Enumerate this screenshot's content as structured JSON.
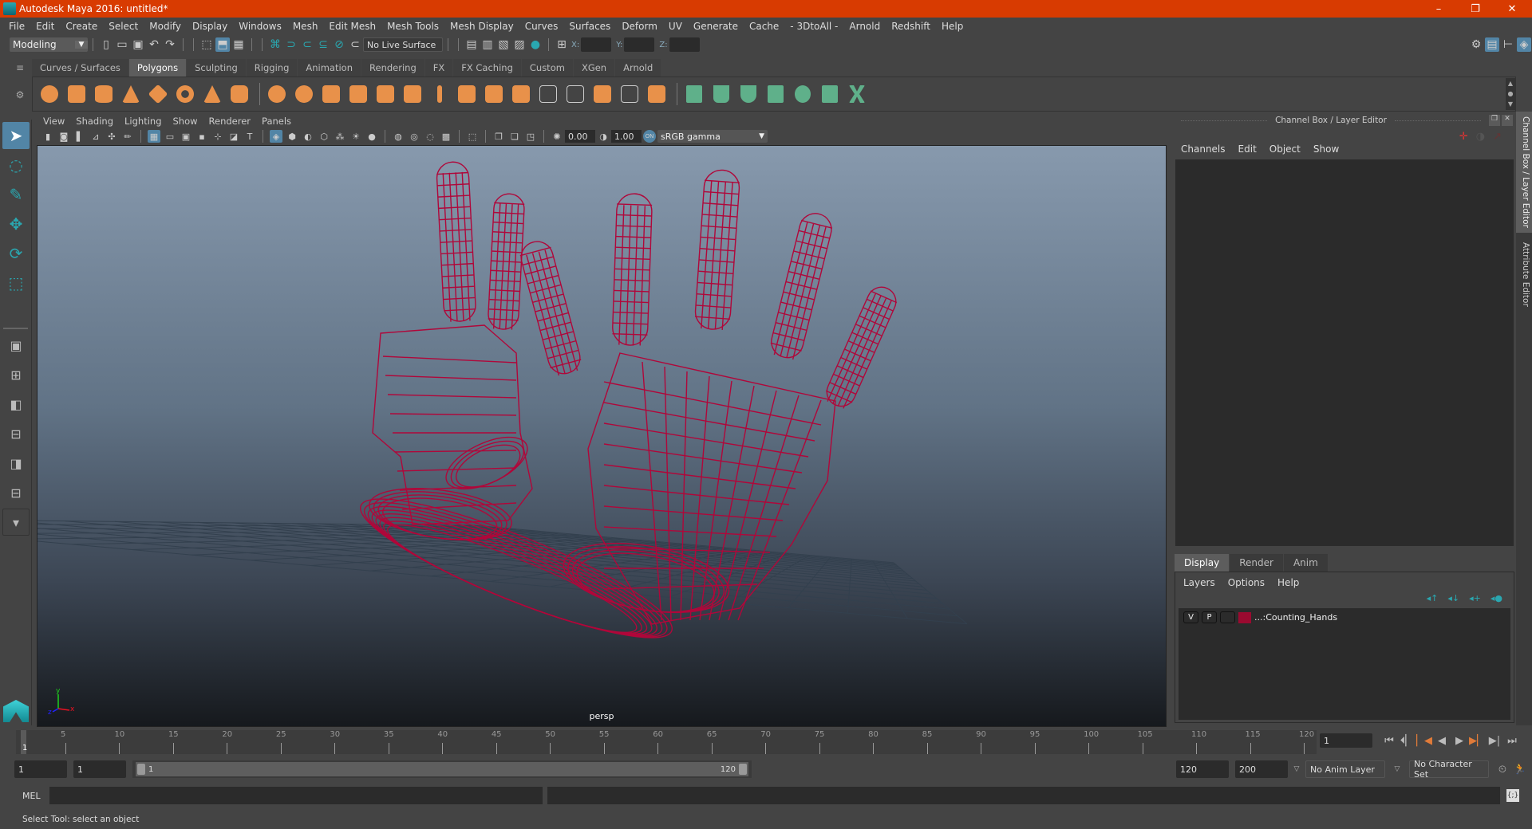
{
  "window": {
    "title": "Autodesk Maya 2016: untitled*",
    "minimize": "–",
    "restore": "❐",
    "close": "✕"
  },
  "menubar": [
    "File",
    "Edit",
    "Create",
    "Select",
    "Modify",
    "Display",
    "Windows",
    "Mesh",
    "Edit Mesh",
    "Mesh Tools",
    "Mesh Display",
    "Curves",
    "Surfaces",
    "Deform",
    "UV",
    "Generate",
    "Cache",
    "- 3DtoAll -",
    "Arnold",
    "Redshift",
    "Help"
  ],
  "statusline": {
    "menuset": "Modeling",
    "live_surface": "No Live Surface",
    "x_label": "X:",
    "y_label": "Y:",
    "z_label": "Z:",
    "x_value": "",
    "y_value": "",
    "z_value": ""
  },
  "shelf": {
    "tabs": [
      "Curves / Surfaces",
      "Polygons",
      "Sculpting",
      "Rigging",
      "Animation",
      "Rendering",
      "FX",
      "FX Caching",
      "Custom",
      "XGen",
      "Arnold"
    ],
    "active_tab": "Polygons"
  },
  "viewport": {
    "menu": [
      "View",
      "Shading",
      "Lighting",
      "Show",
      "Renderer",
      "Panels"
    ],
    "exposure": "0.00",
    "gamma": "1.00",
    "colorspace": "sRGB gamma",
    "camera": "persp",
    "axis": {
      "x": "x",
      "y": "y",
      "z": "z"
    },
    "wire_color": "#b0073a"
  },
  "channel_box": {
    "title": "Channel Box / Layer Editor",
    "menu": [
      "Channels",
      "Edit",
      "Object",
      "Show"
    ]
  },
  "layer_editor": {
    "tabs": [
      "Display",
      "Render",
      "Anim"
    ],
    "active_tab": "Display",
    "menu": [
      "Layers",
      "Options",
      "Help"
    ],
    "layers": [
      {
        "v": "V",
        "p": "P",
        "name": "...:Counting_Hands",
        "color": "#9a0a30"
      }
    ]
  },
  "side_tabs": [
    "Channel Box / Layer Editor",
    "Attribute Editor"
  ],
  "timeline": {
    "ticks": [
      5,
      10,
      15,
      20,
      25,
      30,
      35,
      40,
      45,
      50,
      55,
      60,
      65,
      70,
      75,
      80,
      85,
      90,
      95,
      100,
      105,
      110,
      115,
      120
    ],
    "current_frame": "1",
    "current_frame_field": "1"
  },
  "range": {
    "anim_start": "1",
    "play_start": "1",
    "slider_start": "1",
    "slider_end": "120",
    "play_end": "120",
    "anim_end": "200",
    "anim_layer": "No Anim Layer",
    "character_set": "No Character Set"
  },
  "mel": {
    "label": "MEL"
  },
  "status": "Select Tool: select an object"
}
